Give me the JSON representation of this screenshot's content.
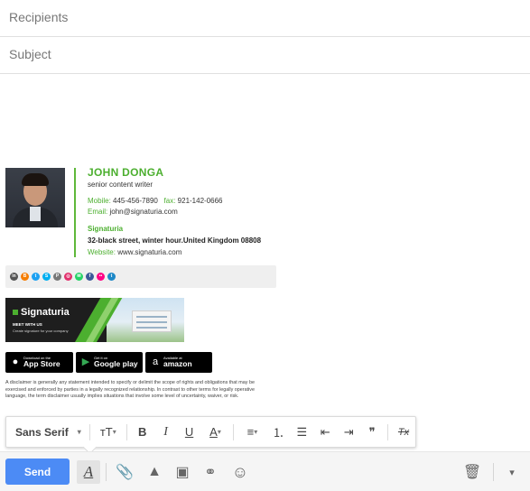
{
  "compose": {
    "recipients_placeholder": "Recipients",
    "subject_placeholder": "Subject"
  },
  "signature": {
    "name": "JOHN DONGA",
    "title": "senior content writer",
    "mobile_label": "Mobile:",
    "mobile": "445-456-7890",
    "fax_label": "fax:",
    "fax": "921-142-0666",
    "email_label": "Email:",
    "email": "john@signaturia.com",
    "company": "Signaturia",
    "address": "32-black street, winter hour.United Kingdom 08808",
    "website_label": "Website:",
    "website": "www.signaturia.com",
    "social_icons": [
      {
        "name": "linkedin-icon",
        "glyph": "in",
        "color": "#555555"
      },
      {
        "name": "blogger-icon",
        "glyph": "B",
        "color": "#f57d00"
      },
      {
        "name": "twitter-icon",
        "glyph": "t",
        "color": "#1da1f2"
      },
      {
        "name": "skype-icon",
        "glyph": "S",
        "color": "#00aff0"
      },
      {
        "name": "pinterest-icon",
        "glyph": "P",
        "color": "#777777"
      },
      {
        "name": "instagram-icon",
        "glyph": "◎",
        "color": "#e1306c"
      },
      {
        "name": "chat-icon",
        "glyph": "✉",
        "color": "#25d366"
      },
      {
        "name": "facebook-icon",
        "glyph": "f",
        "color": "#3b5998"
      },
      {
        "name": "flickr-icon",
        "glyph": "••",
        "color": "#ff0084"
      },
      {
        "name": "tumblr-icon",
        "glyph": "t",
        "color": "#1e88c7"
      }
    ],
    "banner": {
      "brand": "Signaturia",
      "meet": "MEET WITH US",
      "tagline": "Create signature for your company"
    },
    "stores": {
      "app_small": "Download on the",
      "app_big": "App Store",
      "play_small": "Get it on",
      "play_big": "Google play",
      "amazon_small": "Available at",
      "amazon_big": "amazon"
    },
    "disclaimer": "A disclaimer is generally any statement intended to specify or delimit the scope of rights and obligations that may be exercised and enforced by parties in a legally recognized relationship. In contrast to other terms for legally operative language, the term disclaimer usually implies situations that involve some level of uncertainty, waiver, or risk."
  },
  "format_toolbar": {
    "font_family": "Sans Serif",
    "caret": "▾",
    "size_glyph": "тT",
    "bold": "B",
    "italic": "I",
    "underline": "U",
    "text_color": "A",
    "align_glyph": "≡",
    "numbered_glyph": "⒈",
    "bulleted_glyph": "☰",
    "indent_less_glyph": "⇤",
    "indent_more_glyph": "⇥",
    "quote_glyph": "❞",
    "clear_glyph": "Tx"
  },
  "bottom_bar": {
    "send_label": "Send",
    "formatting_glyph": "A",
    "attach_glyph": "📎",
    "drive_glyph": "▲",
    "photo_glyph": "▣",
    "link_glyph": "⚭",
    "emoji_glyph": "☺",
    "trash_glyph": "🗑",
    "more_glyph": "▾"
  }
}
